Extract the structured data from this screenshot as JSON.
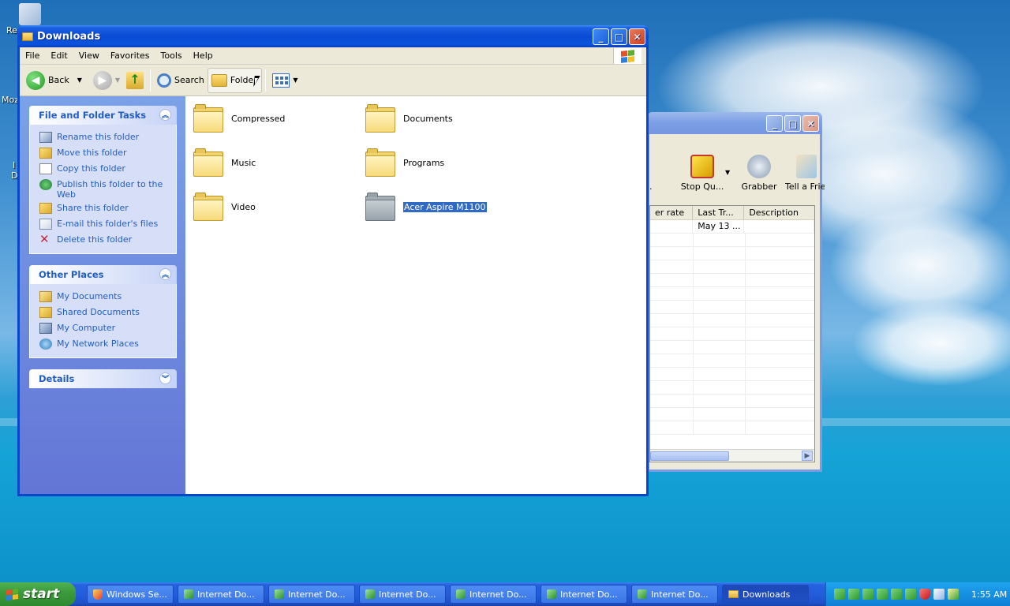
{
  "desktop": {
    "icons": [
      {
        "label": "Re"
      },
      {
        "label": "Moz"
      },
      {
        "label": "I"
      },
      {
        "label": "D"
      }
    ]
  },
  "explorer": {
    "title": "Downloads",
    "menu": [
      "File",
      "Edit",
      "View",
      "Favorites",
      "Tools",
      "Help"
    ],
    "toolbar": {
      "back": "Back",
      "search": "Search",
      "folders": "Folde"
    },
    "file_tasks": {
      "title": "File and Folder Tasks",
      "items": [
        "Rename this folder",
        "Move this folder",
        "Copy this folder",
        "Publish this folder to the Web",
        "Share this folder",
        "E-mail this folder's files",
        "Delete this folder"
      ]
    },
    "other_places": {
      "title": "Other Places",
      "items": [
        "My Documents",
        "Shared Documents",
        "My Computer",
        "My Network Places"
      ]
    },
    "details": {
      "title": "Details"
    },
    "folders": [
      {
        "name": "Compressed"
      },
      {
        "name": "Documents"
      },
      {
        "name": "Music"
      },
      {
        "name": "Programs"
      },
      {
        "name": "Video"
      },
      {
        "name": "Acer Aspire M1100"
      }
    ]
  },
  "idm_window": {
    "toolbar": {
      "stop_queue": "Stop Qu...",
      "grabber": "Grabber",
      "tell_friend": "Tell a Frie"
    },
    "columns": [
      "er rate",
      "Last Tr...",
      "Description"
    ],
    "first_row": {
      "last_try": "May 13 ..."
    }
  },
  "taskbar": {
    "start": "start",
    "buttons": [
      "Windows Se...",
      "Internet Do...",
      "Internet Do...",
      "Internet Do...",
      "Internet Do...",
      "Internet Do...",
      "Internet Do...",
      "Downloads"
    ],
    "clock": "1:55 AM"
  }
}
